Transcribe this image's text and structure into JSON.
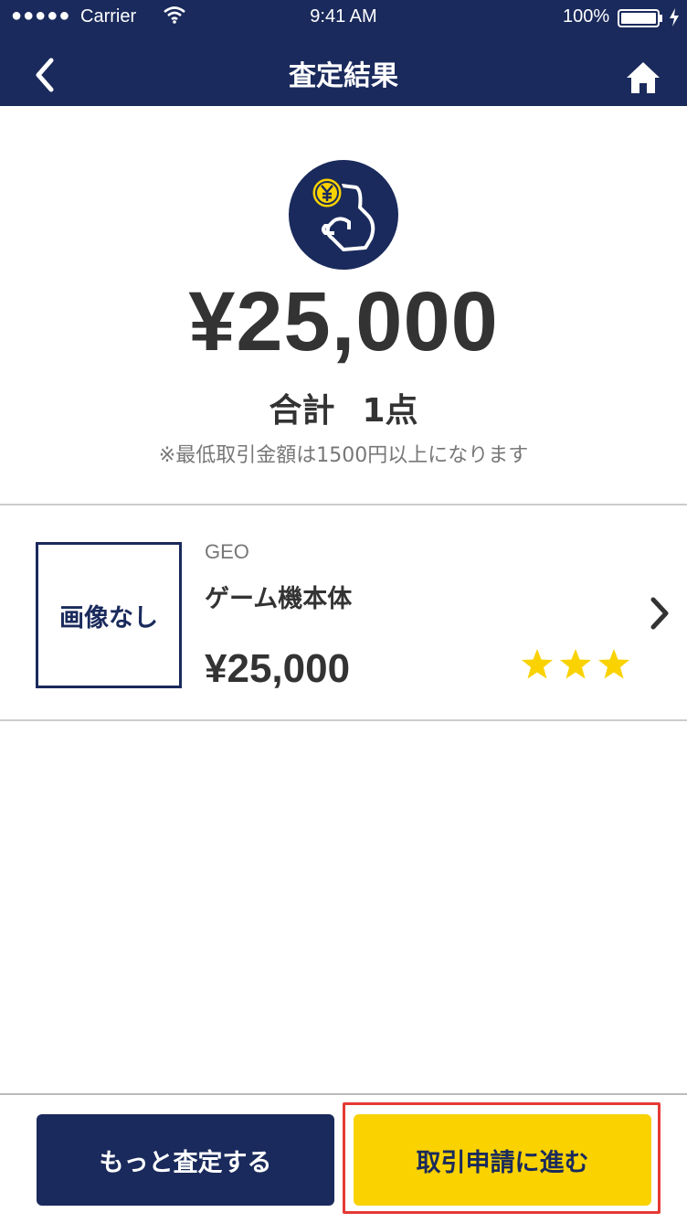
{
  "status_bar": {
    "signal": "●●●●●",
    "carrier": "Carrier",
    "time": "9:41 AM",
    "battery": "100%"
  },
  "nav": {
    "title": "査定結果",
    "back_icon": "chevron-left-icon",
    "home_icon": "home-icon"
  },
  "summary": {
    "total": "¥25,000",
    "count_label": "合計",
    "count_value": "1点",
    "note": "※最低取引金額は1500円以上になります"
  },
  "item": {
    "thumbnail_text": "画像なし",
    "brand": "GEO",
    "name": "ゲーム機本体",
    "price": "¥25,000",
    "rating": 3,
    "rating_max": 3
  },
  "actions": {
    "more_label": "もっと査定する",
    "proceed_label": "取引申請に進む"
  },
  "colors": {
    "navy": "#1a2a5c",
    "yellow": "#f9d200",
    "star": "#f9d200",
    "highlight": "#e53935"
  }
}
